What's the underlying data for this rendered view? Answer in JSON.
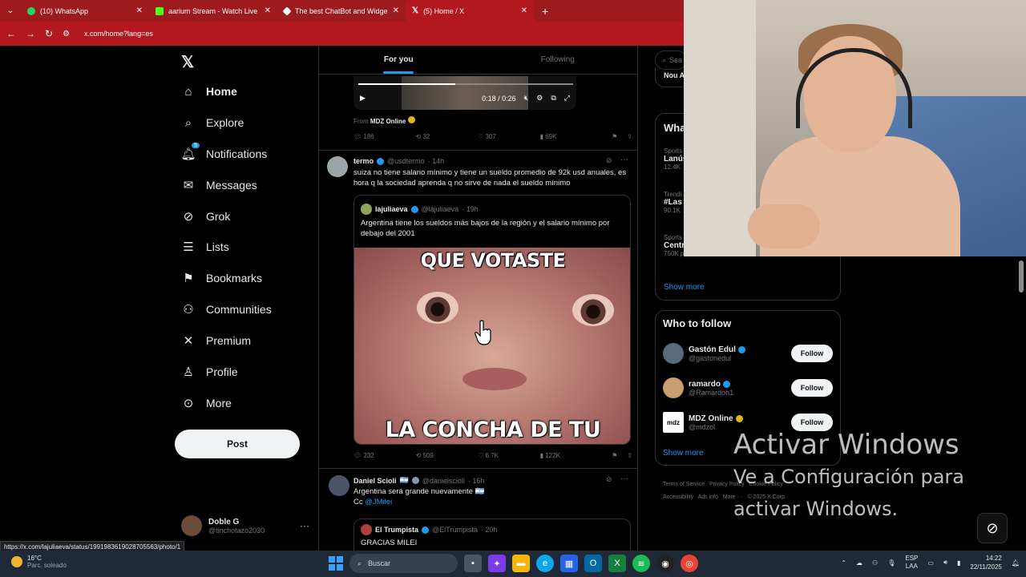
{
  "browser": {
    "tabs": [
      {
        "label": "(10) WhatsApp",
        "color": "#25d366"
      },
      {
        "label": "aarium Stream - Watch Live on",
        "color": "#53fc18"
      },
      {
        "label": "The best ChatBot and Widgets",
        "color": "#ffffff"
      },
      {
        "label": "(5) Home / X",
        "color": "#000000"
      }
    ],
    "url": "x.com/home?lang=es",
    "status_url": "https://x.com/lajuliaeva/status/1991983619028705563/photo/1"
  },
  "nav": {
    "items": [
      {
        "label": "Home",
        "icon": "home-icon"
      },
      {
        "label": "Explore",
        "icon": "search-icon"
      },
      {
        "label": "Notifications",
        "icon": "bell-icon",
        "badge": "5"
      },
      {
        "label": "Messages",
        "icon": "mail-icon"
      },
      {
        "label": "Grok",
        "icon": "grok-icon"
      },
      {
        "label": "Lists",
        "icon": "list-icon"
      },
      {
        "label": "Bookmarks",
        "icon": "bookmark-icon"
      },
      {
        "label": "Communities",
        "icon": "people-icon"
      },
      {
        "label": "Premium",
        "icon": "x-icon"
      },
      {
        "label": "Profile",
        "icon": "user-icon"
      },
      {
        "label": "More",
        "icon": "more-circle-icon"
      }
    ],
    "post_label": "Post",
    "account": {
      "name": "Doble G",
      "handle": "@tinchotazo2030"
    }
  },
  "feed": {
    "tabs": {
      "for_you": "For you",
      "following": "Following"
    },
    "video": {
      "time": "0:18 / 0:26",
      "from_prefix": "From",
      "from_name": "MDZ Online",
      "progress": 0.45
    },
    "post0_stats": {
      "replies": "186",
      "reposts": "32",
      "likes": "307",
      "views": "69K"
    },
    "post1": {
      "name": "termo",
      "handle": "@usdtermo",
      "time": "· 14h",
      "text": "suiza no tiene salario mínimo y tiene un sueldo promedio de 92k usd anuales, es hora q la sociedad aprenda q no sirve de nada el sueldo mínimo",
      "quote": {
        "name": "lajuliaeva",
        "handle": "@lajuliaeva",
        "time": "· 19h",
        "text": "Argentina tiene los sueldos más bajos de la región y el salario mínimo por debajo del 2001",
        "meme_top": "QUE VOTASTE",
        "meme_bottom": "LA CONCHA DE TU MADRE"
      },
      "stats": {
        "replies": "232",
        "reposts": "509",
        "likes": "6.7K",
        "views": "122K"
      }
    },
    "post2": {
      "name": "Daniel Scioli",
      "flag": "🇦🇷",
      "handle": "@danielscioli",
      "time": "· 16h",
      "line1": "Argentina será grande nuevamente 🇦🇷",
      "line2_prefix": "Cc",
      "mention": "@JMilei",
      "quote": {
        "name": "El Trumpista",
        "handle": "@ElTrumpista",
        "time": "· 20h",
        "text": "GRACIAS MILEI"
      }
    }
  },
  "right": {
    "search_placeholder": "Sea",
    "top_snippet": "Nou A",
    "whats_happening": "Wha",
    "trends": [
      {
        "context": "Sports",
        "name": "Lanús",
        "posts": "12.4K"
      },
      {
        "context": "Trendi",
        "name": "#Las",
        "posts": "90.1K"
      },
      {
        "context": "Sports",
        "name": "Centr",
        "posts": "750K posts"
      }
    ],
    "show_more": "Show more",
    "who_to_follow": "Who to follow",
    "follow_suggestions": [
      {
        "name": "Gastón Edul",
        "handle": "@gastonedul",
        "badge": "blue",
        "avatar_color": "#5a6a7a"
      },
      {
        "name": "ramardo",
        "handle": "@Ramardoh1",
        "badge": "blue",
        "avatar_color": "#c8a070"
      },
      {
        "name": "MDZ Online",
        "handle": "@mdzol",
        "badge": "gold",
        "avatar_color": "#ffffff"
      }
    ],
    "follow_label": "Follow",
    "footer": [
      "Terms of Service",
      "Privacy Policy",
      "Cookie Policy",
      "Accessibility",
      "Ads info",
      "More ···",
      "© 2025 X Corp."
    ]
  },
  "watermark": {
    "line1": "Activar Windows",
    "line2": "Ve a Configuración para",
    "line3": "activar Windows."
  },
  "taskbar": {
    "temp": "16°C",
    "weather": "Parc. soleado",
    "search": "Buscar",
    "lang": "ESP",
    "lang2": "LAA",
    "time": "14:22",
    "date": "22/11/2025"
  }
}
